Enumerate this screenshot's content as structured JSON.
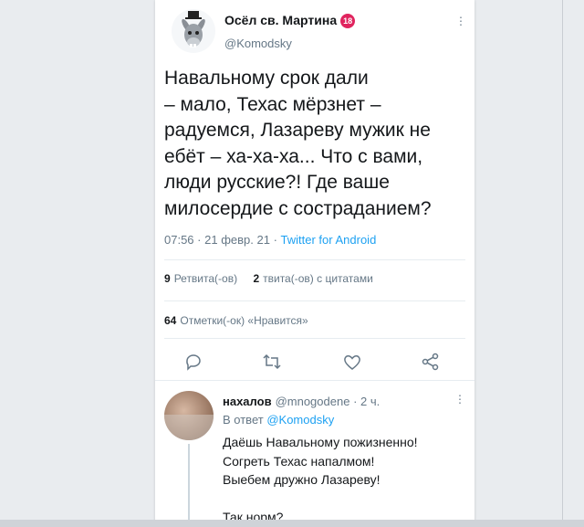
{
  "tweet": {
    "display_name": "Осёл св. Мартина",
    "age_badge": "18",
    "handle": "@Komodsky",
    "text": "Навальному срок дали\n– мало, Техас мёрзнет –\nрадуемся, Лазареву мужик не\nебёт – ха-ха-ха... Что с вами,\nлюди русские?! Где ваше\nмилосердие с состраданием?",
    "time": "07:56",
    "date": "21 февр. 21",
    "client": "Twitter for Android",
    "retweets_count": "9",
    "retweets_label": "Ретвита(-ов)",
    "quotes_count": "2",
    "quotes_label": "твита(-ов) с цитатами",
    "likes_count": "64",
    "likes_label": "Отметки(-ок) «Нравится»",
    "more_icon": "more-dots-icon"
  },
  "actions": {
    "reply_icon": "reply-icon",
    "retweet_icon": "retweet-icon",
    "like_icon": "heart-icon",
    "share_icon": "share-icon"
  },
  "reply": {
    "name": "нахалов",
    "handle": "@mnogodene",
    "time": "2 ч.",
    "replying_to_prefix": "В ответ",
    "replying_to_handle": "@Komodsky",
    "text": "Даёшь Навальному пожизненно!\nСогреть Техас напалмом!\nВыебем дружно Лазареву!\n\nТак норм?"
  },
  "colors": {
    "accent": "#1da1f2",
    "text": "#14171a",
    "secondary": "#657786",
    "background": "#e9ecef",
    "badge": "#e0245e"
  }
}
